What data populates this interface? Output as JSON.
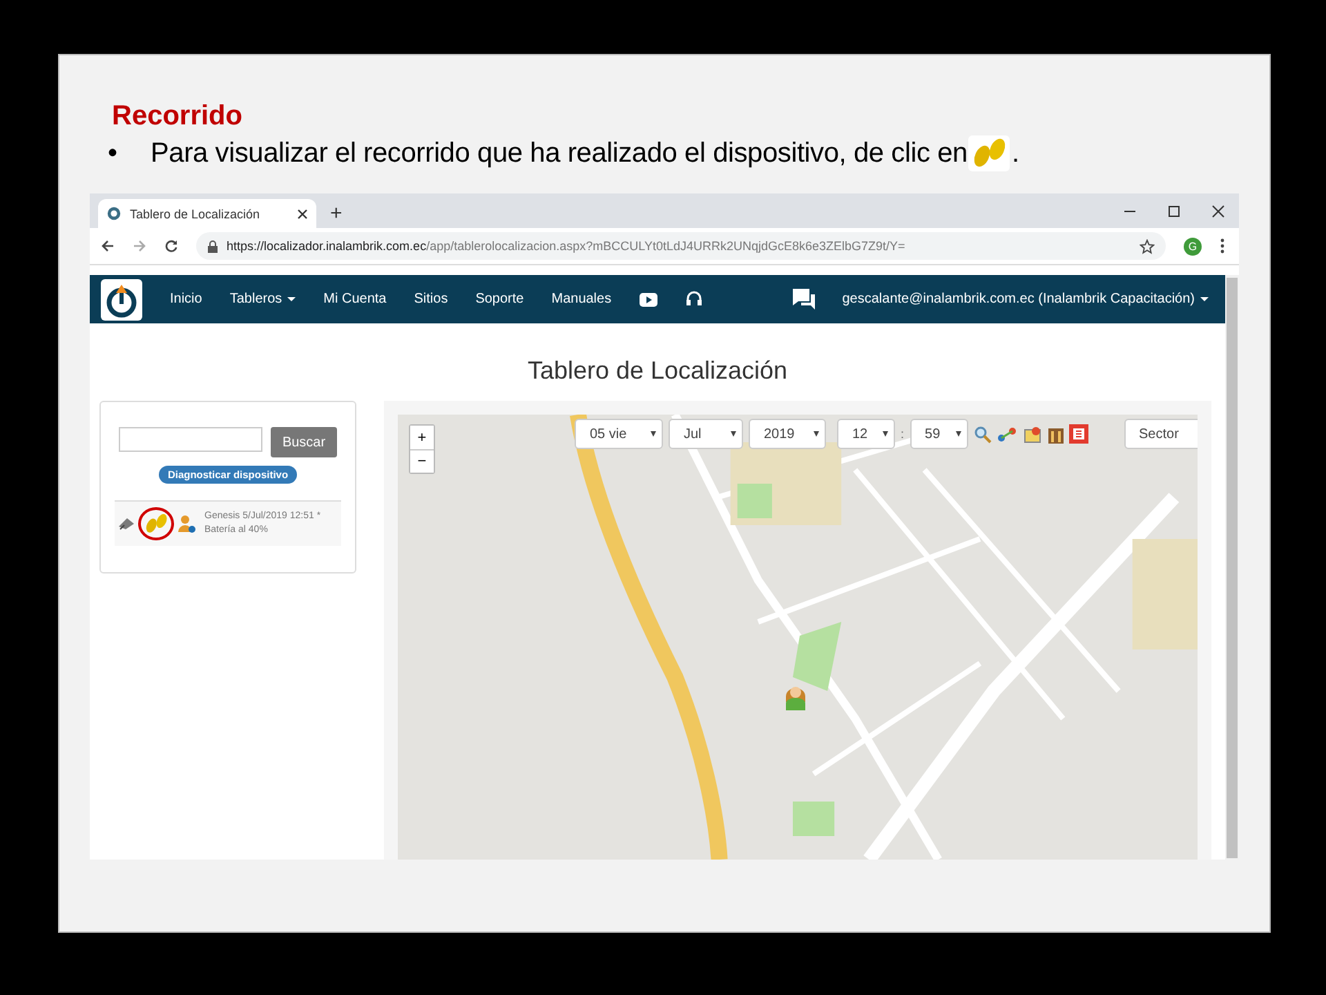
{
  "slide": {
    "title": "Recorrido",
    "bullet": "•",
    "text": "Para visualizar el recorrido que ha realizado el dispositivo, de clic en",
    "end": "."
  },
  "browser": {
    "tab_title": "Tablero de Localización",
    "new_tab": "+",
    "url_host": "https://localizador.inalambrik.com.ec",
    "url_path": "/app/tablerolocalizacion.aspx?mBCCULYt0tLdJ4URRk2UNqjdGcE8k6e3ZElbG7Z9t/Y=",
    "avatar": "G"
  },
  "navbar": {
    "items": [
      {
        "label": "Inicio",
        "dropdown": false
      },
      {
        "label": "Tableros",
        "dropdown": true
      },
      {
        "label": "Mi Cuenta",
        "dropdown": false
      },
      {
        "label": "Sitios",
        "dropdown": false
      },
      {
        "label": "Soporte",
        "dropdown": false
      },
      {
        "label": "Manuales",
        "dropdown": false
      }
    ],
    "user": "gescalante@inalambrik.com.ec (Inalambrik Capacitación)"
  },
  "page_title": "Tablero de Localización",
  "search": {
    "button": "Buscar",
    "diagnose": "Diagnosticar dispositivo"
  },
  "device": {
    "line1": "Genesis 5/Jul/2019 12:51 *",
    "line2": "Batería al 40%",
    "highlighted": true
  },
  "map": {
    "zoom_in": "+",
    "zoom_out": "−",
    "selects": [
      {
        "value": "05 vie"
      },
      {
        "value": "Jul"
      },
      {
        "value": "2019"
      },
      {
        "value": "12"
      },
      {
        "value": "59"
      }
    ],
    "time_separator": ":",
    "sector": "Sector"
  }
}
